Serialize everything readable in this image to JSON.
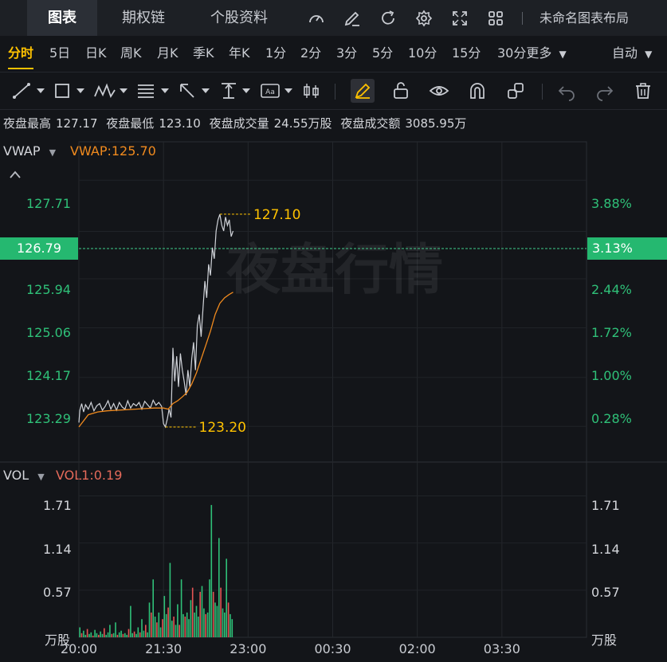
{
  "nav": {
    "tabs": [
      {
        "label": "图表",
        "active": true
      },
      {
        "label": "期权链",
        "active": false
      },
      {
        "label": "个股资料",
        "active": false
      }
    ],
    "layout_label": "未命名图表布局",
    "icons": [
      "gauge-icon",
      "edit-icon",
      "refresh-icon",
      "gear-icon",
      "fullscreen-icon",
      "grid-icon"
    ]
  },
  "periods": {
    "items": [
      "分时",
      "5日",
      "日K",
      "周K",
      "月K",
      "季K",
      "年K",
      "1分",
      "2分",
      "3分",
      "5分",
      "10分",
      "15分"
    ],
    "more": "30分更多",
    "active": "分时",
    "auto_label": "自动"
  },
  "stats": [
    {
      "label": "夜盘最高",
      "value": "127.17"
    },
    {
      "label": "夜盘最低",
      "value": "123.10"
    },
    {
      "label": "夜盘成交量",
      "value": "24.55万股"
    },
    {
      "label": "夜盘成交额",
      "value": "3085.95万"
    }
  ],
  "watermark": "夜盘行情",
  "colors": {
    "accent": "#ffc200",
    "up": "#2fc078",
    "down": "#e65454",
    "price_line": "#d0d3d9",
    "vwap_line": "#f08a1e",
    "bg": "#131519"
  },
  "chart_data": [
    {
      "type": "line",
      "indicator": "VWAP",
      "indicator_value": "VWAP:125.70",
      "x_ticks": [
        "20:00",
        "21:30",
        "23:00",
        "00:30",
        "02:00",
        "03:30"
      ],
      "x_tick_minutes": [
        0,
        90,
        180,
        270,
        360,
        450
      ],
      "ylim": [
        122.65,
        128.4
      ],
      "y_ticks": [
        "127.71",
        "126.79",
        "125.94",
        "125.06",
        "124.17",
        "123.29"
      ],
      "y_right_ticks": [
        "3.88%",
        "3.13%",
        "2.44%",
        "1.72%",
        "1.00%",
        "0.28%"
      ],
      "current_price": "126.79",
      "current_pct": "3.13%",
      "high_label": "127.10",
      "low_label": "123.20",
      "series": [
        {
          "role": "price",
          "x_min": [
            0,
            1,
            3,
            5,
            7,
            10,
            13,
            16,
            19,
            22,
            25,
            28,
            31,
            34,
            37,
            40,
            43,
            46,
            49,
            52,
            55,
            58,
            61,
            64,
            67,
            70,
            73,
            76,
            79,
            82,
            85,
            88,
            90,
            92,
            94,
            96,
            98,
            100,
            102,
            104,
            106,
            108,
            110,
            112,
            114,
            116,
            118,
            120,
            122,
            124,
            126,
            128,
            130,
            132,
            134,
            136,
            138,
            140,
            142,
            144,
            146,
            148,
            150,
            152,
            154,
            156,
            158,
            160,
            162,
            164
          ],
          "y": [
            123.36,
            123.58,
            123.7,
            123.55,
            123.68,
            123.6,
            123.72,
            123.57,
            123.66,
            123.7,
            123.58,
            123.65,
            123.75,
            123.6,
            123.7,
            123.58,
            123.72,
            123.64,
            123.6,
            123.75,
            123.62,
            123.7,
            123.66,
            123.72,
            123.6,
            123.74,
            123.68,
            123.62,
            123.76,
            123.67,
            123.72,
            123.65,
            123.34,
            123.28,
            123.42,
            123.6,
            123.45,
            124.7,
            124.1,
            124.55,
            124.0,
            124.6,
            124.3,
            124.1,
            123.85,
            124.3,
            124.0,
            124.5,
            124.8,
            124.3,
            125.1,
            125.3,
            124.9,
            125.4,
            125.9,
            125.6,
            126.2,
            126.0,
            126.5,
            126.3,
            126.8,
            127.0,
            127.1,
            126.9,
            126.8,
            127.05,
            126.9,
            127.0,
            126.7,
            126.8
          ]
        },
        {
          "role": "vwap",
          "x_min": [
            0,
            10,
            20,
            30,
            40,
            50,
            60,
            70,
            80,
            90,
            95,
            100,
            105,
            110,
            115,
            120,
            125,
            130,
            135,
            140,
            145,
            150,
            155,
            160,
            164
          ],
          "y": [
            123.28,
            123.5,
            123.55,
            123.57,
            123.58,
            123.59,
            123.6,
            123.61,
            123.62,
            123.62,
            123.6,
            123.7,
            123.75,
            123.82,
            123.9,
            124.05,
            124.25,
            124.5,
            124.75,
            125.0,
            125.3,
            125.5,
            125.6,
            125.66,
            125.7
          ]
        }
      ]
    },
    {
      "type": "bar",
      "indicator": "VOL",
      "indicator_value": "VOL1:0.19",
      "unit": "万股",
      "ylim": [
        0,
        2.1
      ],
      "y_ticks": [
        "1.71",
        "1.14",
        "0.57"
      ],
      "x_min": [
        1,
        3,
        5,
        7,
        9,
        11,
        13,
        15,
        17,
        19,
        21,
        23,
        25,
        27,
        29,
        31,
        33,
        35,
        37,
        39,
        41,
        43,
        45,
        47,
        49,
        51,
        53,
        55,
        57,
        59,
        61,
        63,
        65,
        67,
        69,
        71,
        73,
        75,
        77,
        79,
        81,
        83,
        85,
        87,
        89,
        91,
        93,
        95,
        97,
        99,
        101,
        103,
        105,
        107,
        109,
        111,
        113,
        115,
        117,
        119,
        121,
        123,
        125,
        127,
        129,
        131,
        133,
        135,
        137,
        139,
        141,
        143,
        145,
        147,
        149,
        151,
        153,
        155,
        157,
        159,
        161,
        163
      ],
      "values": [
        0.12,
        0.05,
        0.08,
        0.03,
        0.1,
        0.04,
        0.06,
        0.02,
        0.09,
        0.05,
        0.03,
        0.07,
        0.04,
        0.11,
        0.03,
        0.06,
        0.15,
        0.04,
        0.05,
        0.18,
        0.03,
        0.06,
        0.08,
        0.04,
        0.05,
        0.03,
        0.1,
        0.38,
        0.05,
        0.07,
        0.04,
        0.12,
        0.06,
        0.22,
        0.08,
        0.15,
        0.06,
        0.42,
        0.3,
        0.7,
        0.25,
        0.18,
        0.3,
        0.12,
        0.22,
        0.5,
        0.28,
        0.36,
        0.9,
        0.2,
        0.25,
        0.15,
        0.4,
        0.15,
        0.7,
        0.28,
        0.25,
        0.3,
        0.22,
        0.45,
        0.6,
        0.3,
        0.38,
        0.25,
        0.55,
        0.62,
        0.35,
        0.28,
        0.3,
        0.7,
        1.6,
        0.55,
        0.42,
        0.38,
        1.2,
        0.6,
        0.35,
        0.3,
        0.95,
        0.42,
        0.28,
        0.22
      ],
      "colors": [
        "up",
        "down",
        "up",
        "up",
        "down",
        "up",
        "up",
        "down",
        "up",
        "up",
        "down",
        "up",
        "up",
        "down",
        "up",
        "up",
        "up",
        "down",
        "up",
        "up",
        "down",
        "up",
        "up",
        "down",
        "up",
        "up",
        "down",
        "up",
        "up",
        "down",
        "up",
        "up",
        "down",
        "up",
        "up",
        "down",
        "up",
        "up",
        "down",
        "up",
        "up",
        "down",
        "up",
        "up",
        "down",
        "up",
        "up",
        "down",
        "up",
        "up",
        "down",
        "up",
        "up",
        "down",
        "up",
        "up",
        "down",
        "up",
        "up",
        "up",
        "down",
        "up",
        "up",
        "up",
        "down",
        "up",
        "up",
        "down",
        "up",
        "up",
        "up",
        "down",
        "up",
        "up",
        "up",
        "down",
        "up",
        "up",
        "up",
        "down",
        "up",
        "up"
      ]
    }
  ]
}
